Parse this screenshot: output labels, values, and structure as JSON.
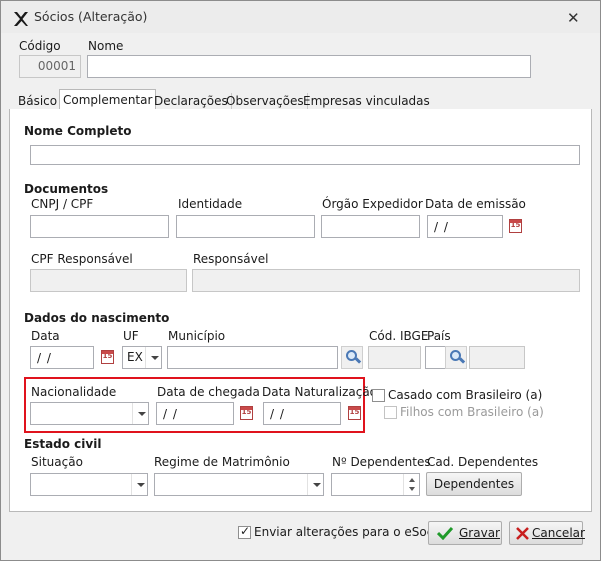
{
  "window": {
    "title": "Sócios (Alteração)",
    "close_symbol": "✕"
  },
  "header": {
    "codigo_label": "Código",
    "codigo_value": "00001",
    "nome_label": "Nome",
    "nome_value": ""
  },
  "tabs": [
    {
      "label": "Básico"
    },
    {
      "label": "Complementar"
    },
    {
      "label": "Declarações"
    },
    {
      "label": "Observações"
    },
    {
      "label": "Empresas vinculadas"
    }
  ],
  "nome_completo": {
    "section": "Nome Completo",
    "value": ""
  },
  "documentos": {
    "section": "Documentos",
    "cnpj_label": "CNPJ / CPF",
    "identidade_label": "Identidade",
    "orgao_label": "Órgão Expedidor",
    "data_emissao_label": "Data de emissão",
    "data_emissao_value": "/ /",
    "cpf_resp_label": "CPF Responsável",
    "responsavel_label": "Responsável"
  },
  "nascimento": {
    "section": "Dados do nascimento",
    "data_label": "Data",
    "data_value": "/ /",
    "uf_label": "UF",
    "uf_value": "EX",
    "municipio_label": "Município",
    "cod_ibge_label": "Cód. IBGE",
    "pais_label": "País"
  },
  "naturalizacao": {
    "nacionalidade_label": "Nacionalidade",
    "data_chegada_label": "Data de chegada",
    "data_chegada_value": "/ /",
    "data_naturalizacao_label": "Data Naturalização",
    "data_naturalizacao_value": "/ /"
  },
  "flags": {
    "casado_label": "Casado com Brasileiro (a)",
    "filhos_label": "Filhos com Brasileiro (a)"
  },
  "estado_civil": {
    "section": "Estado civil",
    "situacao_label": "Situação",
    "regime_label": "Regime de Matrimônio",
    "dependentes_label": "Nº Dependentes",
    "cad_dependentes_label": "Cad. Dependentes",
    "dependentes_button": "Dependentes"
  },
  "footer": {
    "esocial_label": "Enviar alterações para o eSocial",
    "gravar": "Gravar",
    "cancelar": "Cancelar"
  },
  "icons": {
    "calendar": "calendar-icon",
    "search": "search-icon",
    "check": "check-icon",
    "close": "close-x-icon"
  },
  "colors": {
    "highlight_box": "#e0131d",
    "gravar_icon": "#1f9a2a",
    "cancelar_icon": "#c81e1e"
  }
}
